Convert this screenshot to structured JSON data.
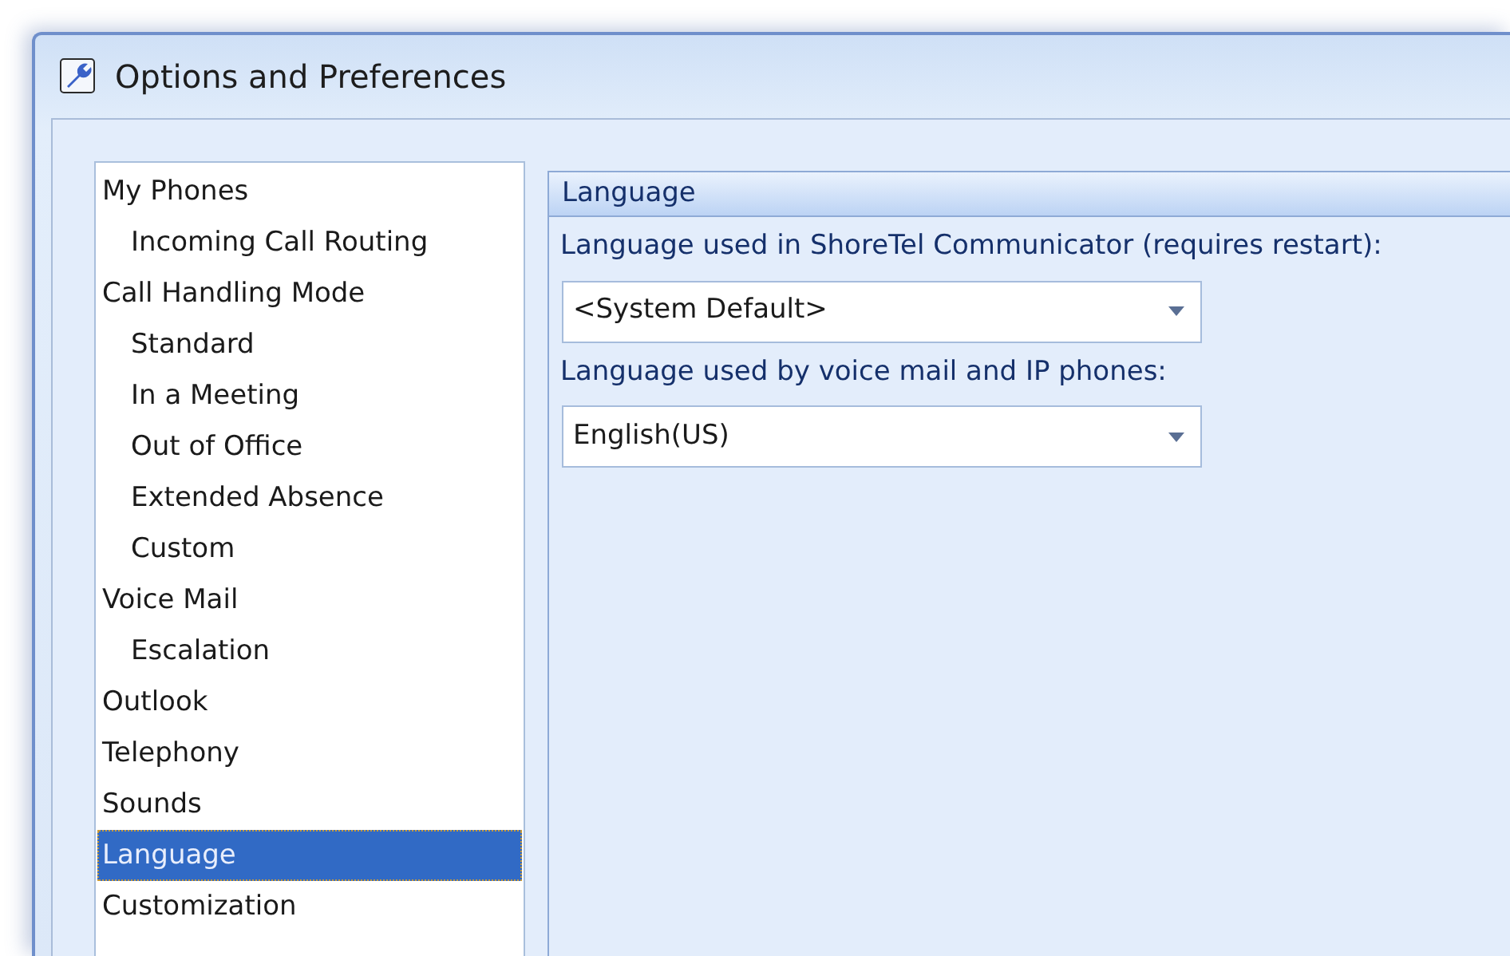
{
  "window": {
    "title": "Options and Preferences"
  },
  "tree": {
    "items": [
      {
        "label": "My Phones",
        "selected": false,
        "children": [
          {
            "label": "Incoming Call Routing",
            "selected": false
          }
        ]
      },
      {
        "label": "Call Handling Mode",
        "selected": false,
        "children": [
          {
            "label": "Standard",
            "selected": false
          },
          {
            "label": "In a Meeting",
            "selected": false
          },
          {
            "label": "Out of Office",
            "selected": false
          },
          {
            "label": "Extended Absence",
            "selected": false
          },
          {
            "label": "Custom",
            "selected": false
          }
        ]
      },
      {
        "label": "Voice Mail",
        "selected": false,
        "children": [
          {
            "label": "Escalation",
            "selected": false
          }
        ]
      },
      {
        "label": "Outlook",
        "selected": false
      },
      {
        "label": "Telephony",
        "selected": false
      },
      {
        "label": "Sounds",
        "selected": false
      },
      {
        "label": "Language",
        "selected": true
      },
      {
        "label": "Customization",
        "selected": false
      }
    ]
  },
  "panel": {
    "title": "Language",
    "fields": [
      {
        "label": "Language used in ShoreTel Communicator (requires restart):",
        "value": "<System Default>"
      },
      {
        "label": "Language used by voice mail and IP phones:",
        "value": "English(US)"
      }
    ]
  }
}
